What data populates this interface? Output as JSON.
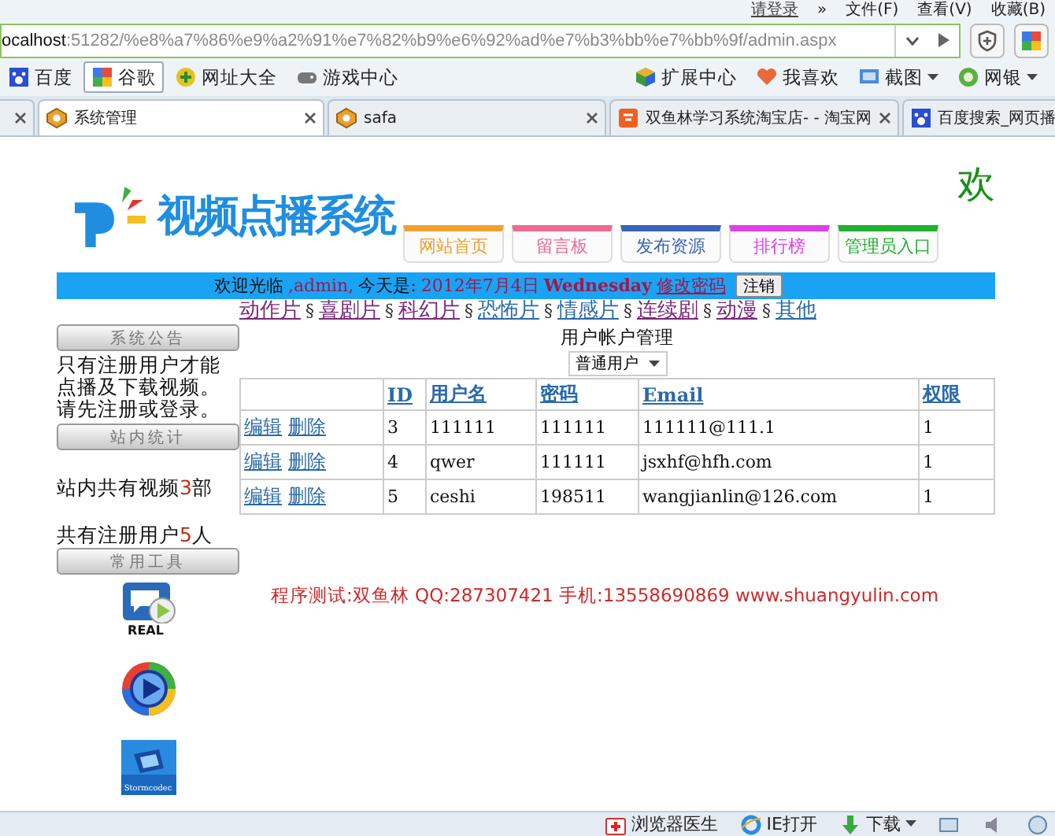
{
  "menu_bar": {
    "login": "请登录",
    "chevron": "»",
    "items": [
      "文件(F)",
      "查看(V)",
      "收藏(B)"
    ]
  },
  "address_bar": {
    "url_host": "ocalhost",
    "url_rest": ":51282/%e8%a7%86%e9%a2%91%e7%82%b9%e6%92%ad%e7%b3%bb%e7%bb%9f/admin.aspx"
  },
  "bookmarks_left": [
    {
      "label": "百度",
      "selected": false
    },
    {
      "label": "谷歌",
      "selected": true
    },
    {
      "label": "网址大全",
      "selected": false
    },
    {
      "label": "游戏中心",
      "selected": false
    }
  ],
  "bookmarks_right": [
    {
      "label": "扩展中心",
      "menu": false
    },
    {
      "label": "我喜欢",
      "menu": false
    },
    {
      "label": "截图",
      "menu": true
    },
    {
      "label": "网银",
      "menu": true
    }
  ],
  "tabs": [
    {
      "label": "系统管理",
      "selected": true
    },
    {
      "label": "safa",
      "selected": false
    },
    {
      "label": "双鱼林学习系统淘宝店- - 淘宝网",
      "selected": false
    },
    {
      "label": "百度搜索_网页播",
      "selected": false
    }
  ],
  "logo": {
    "title": "视频点播系统"
  },
  "nav": [
    {
      "label": "网站首页",
      "color": "#f0a030"
    },
    {
      "label": "留言板",
      "color": "#ee6a92"
    },
    {
      "label": "发布资源",
      "color": "#3a62b8"
    },
    {
      "label": "排行榜",
      "color": "#e040e8"
    },
    {
      "label": "管理员入口",
      "color": "#20b030"
    }
  ],
  "corner_text": "欢",
  "welcome_bar": {
    "greeting": "欢迎光临",
    "user": ",admin,",
    "today_label": "今天是:",
    "date": "2012年7月4日",
    "weekday": "Wednesday",
    "change_password": "修改密码",
    "logout": "注销"
  },
  "categories": [
    {
      "label": "动作片",
      "visited": true
    },
    {
      "mark": "§",
      "label": "喜剧片",
      "visited": true
    },
    {
      "mark": "§",
      "label": "科幻片",
      "visited": true
    },
    {
      "mark": "§",
      "label": "恐怖片",
      "visited": false
    },
    {
      "mark": "§",
      "label": "情感片",
      "visited": false
    },
    {
      "mark": "§",
      "label": "连续剧",
      "visited": true
    },
    {
      "mark": "§",
      "label": "动漫",
      "visited": true
    },
    {
      "mark": "§",
      "label": "其他",
      "visited": false
    }
  ],
  "sidebar": {
    "notice_button": "系统公告",
    "notice_text": "只有注册用户才能点播及下载视频。请先注册或登录。",
    "stats_button": "站内统计",
    "stats": [
      {
        "before": "站内共有视频",
        "count": "3",
        "after": "部"
      },
      {
        "before": "共有注册用户",
        "count": "5",
        "after": "人"
      }
    ],
    "tools_button": "常用工具",
    "tools": [
      {
        "kind": "real",
        "label": "REAL"
      },
      {
        "kind": "wmp"
      },
      {
        "kind": "storm",
        "label": "Stormcodec"
      }
    ]
  },
  "account_panel": {
    "title": "用户帐户管理",
    "filter": "普通用户",
    "columns": [
      "ID",
      "用户名",
      "密码",
      "Email",
      "权限"
    ],
    "rows": [
      {
        "edit": "编辑",
        "delete": "删除",
        "cells": [
          "3",
          "111111",
          "111111",
          "111111@111.1",
          "1"
        ]
      },
      {
        "edit": "编辑",
        "delete": "删除",
        "cells": [
          "4",
          "qwer",
          "111111",
          "jsxhf@hfh.com",
          "1"
        ]
      },
      {
        "edit": "编辑",
        "delete": "删除",
        "cells": [
          "5",
          "ceshi",
          "198511",
          "wangjianlin@126.com",
          "1"
        ]
      }
    ]
  },
  "footer_note": "程序测试:双鱼林 QQ:287307421 手机:13558690869 www.shuangyulin.com",
  "status_bar": {
    "items": [
      {
        "label": "浏览器医生",
        "menu": false
      },
      {
        "label": "IE打开",
        "menu": false
      },
      {
        "label": "下载",
        "menu": true
      }
    ]
  }
}
